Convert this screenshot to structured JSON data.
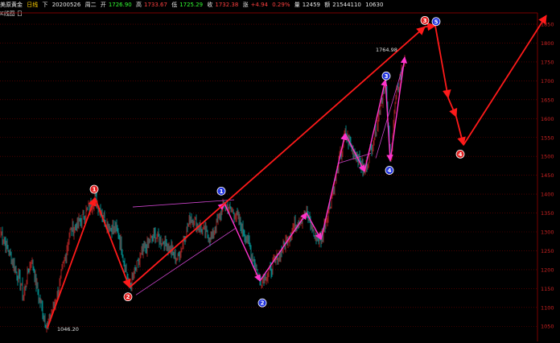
{
  "header": {
    "symbol": "美原黄金",
    "period": "日线",
    "adjust": "下",
    "date": "20200526",
    "weekday": "周二",
    "open_label": "开",
    "open": "1726.90",
    "high_label": "高",
    "high": "1733.67",
    "low_label": "低",
    "low": "1725.29",
    "close_label": "收",
    "close": "1732.38",
    "change_label": "涨",
    "change": "+4.94",
    "change_pct": "0.29%",
    "volume_label": "量",
    "volume": "12459",
    "amount_label": "额",
    "amount": "21544110",
    "position": "10630"
  },
  "subtitle": "K线图 日",
  "colors": {
    "background": "#000000",
    "up_candle": "#ff3333",
    "down_candle": "#00e0e0",
    "wave_arrow": "#ff1a1a",
    "sub_arrow": "#ff33cc",
    "channel": "#cc44cc",
    "grid": "#7a0000",
    "axis_text": "#cc2222",
    "red_marker": "#e02020",
    "blue_marker": "#2233dd"
  },
  "chart_data": {
    "type": "candlestick",
    "title": "美原黄金 日线",
    "ylim": [
      1010,
      1880
    ],
    "y_ticks": [
      1050,
      1100,
      1150,
      1200,
      1250,
      1300,
      1350,
      1400,
      1450,
      1500,
      1550,
      1600,
      1650,
      1700,
      1750,
      1800,
      1850
    ],
    "grid": true,
    "annotations": [
      {
        "text": "1046.20",
        "price": 1046.2
      },
      {
        "text": "1764.98",
        "price": 1764.98
      }
    ],
    "wave_labels": [
      {
        "label": "1",
        "style": "red",
        "price": 1413
      },
      {
        "label": "2",
        "style": "red",
        "price": 1128
      },
      {
        "label": "1",
        "style": "blue",
        "price": 1408
      },
      {
        "label": "2",
        "style": "blue",
        "price": 1112
      },
      {
        "label": "3",
        "style": "blue",
        "price": 1713
      },
      {
        "label": "4",
        "style": "blue",
        "price": 1463
      },
      {
        "label": "3",
        "style": "red",
        "price": 1860
      },
      {
        "label": "5",
        "style": "blue",
        "price": 1857
      },
      {
        "label": "4",
        "style": "red",
        "price": 1506
      }
    ],
    "main_wave_path": [
      {
        "bar": 58,
        "price": 1046
      },
      {
        "bar": 117,
        "price": 1390
      },
      {
        "bar": 160,
        "price": 1153
      },
      {
        "bar": 527,
        "price": 1843
      },
      {
        "bar": 540,
        "price": 1846
      },
      {
        "bar": 556,
        "price": 1655
      },
      {
        "bar": 566,
        "price": 1605
      },
      {
        "bar": 575,
        "price": 1530
      },
      {
        "bar": 678,
        "price": 1873
      }
    ],
    "sub_wave_path": [
      {
        "bar": 160,
        "price": 1153
      },
      {
        "bar": 278,
        "price": 1375
      },
      {
        "bar": 322,
        "price": 1170
      },
      {
        "bar": 380,
        "price": 1350
      },
      {
        "bar": 398,
        "price": 1280
      },
      {
        "bar": 428,
        "price": 1560
      },
      {
        "bar": 452,
        "price": 1460
      },
      {
        "bar": 478,
        "price": 1703
      },
      {
        "bar": 484,
        "price": 1488
      },
      {
        "bar": 502,
        "price": 1763
      }
    ],
    "channel_lines": [
      {
        "from": {
          "bar": 164,
          "price": 1366
        },
        "to": {
          "bar": 290,
          "price": 1385
        }
      },
      {
        "from": {
          "bar": 168,
          "price": 1133
        },
        "to": {
          "bar": 292,
          "price": 1310
        }
      },
      {
        "from": {
          "bar": 420,
          "price": 1482
        },
        "to": {
          "bar": 460,
          "price": 1508
        }
      },
      {
        "from": {
          "bar": 466,
          "price": 1495
        },
        "to": {
          "bar": 500,
          "price": 1740
        }
      }
    ],
    "price_anchors": [
      [
        0,
        1300
      ],
      [
        18,
        1205
      ],
      [
        28,
        1135
      ],
      [
        38,
        1230
      ],
      [
        48,
        1120
      ],
      [
        58,
        1046
      ],
      [
        72,
        1150
      ],
      [
        86,
        1300
      ],
      [
        100,
        1330
      ],
      [
        117,
        1390
      ],
      [
        132,
        1320
      ],
      [
        146,
        1300
      ],
      [
        160,
        1153
      ],
      [
        175,
        1240
      ],
      [
        190,
        1290
      ],
      [
        205,
        1270
      ],
      [
        220,
        1230
      ],
      [
        236,
        1340
      ],
      [
        250,
        1305
      ],
      [
        262,
        1285
      ],
      [
        278,
        1375
      ],
      [
        292,
        1345
      ],
      [
        306,
        1280
      ],
      [
        322,
        1170
      ],
      [
        336,
        1200
      ],
      [
        350,
        1255
      ],
      [
        364,
        1315
      ],
      [
        380,
        1350
      ],
      [
        390,
        1290
      ],
      [
        398,
        1280
      ],
      [
        412,
        1400
      ],
      [
        428,
        1560
      ],
      [
        440,
        1510
      ],
      [
        452,
        1460
      ],
      [
        466,
        1570
      ],
      [
        478,
        1703
      ],
      [
        484,
        1488
      ],
      [
        490,
        1640
      ],
      [
        502,
        1763
      ]
    ],
    "last_bar": {
      "date": "20200526",
      "open": 1726.9,
      "high": 1733.67,
      "low": 1725.29,
      "close": 1732.38,
      "change": 4.94,
      "change_pct": 0.29,
      "volume": 12459,
      "amount": 21544110,
      "open_interest": 10630
    }
  }
}
